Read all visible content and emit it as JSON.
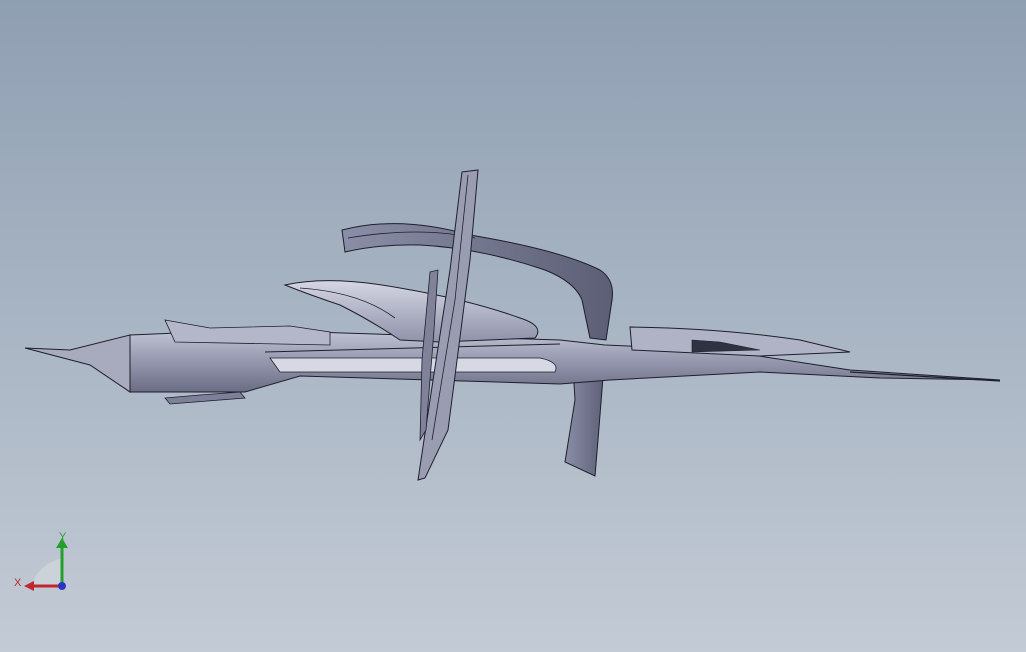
{
  "viewport": {
    "model_icon": "cad-assembly-aircraft",
    "colors": {
      "background_top": "#8f9fb2",
      "background_bottom": "#c3cbd5",
      "part_light": "#b9bdd0",
      "part_mid": "#8d91a8",
      "part_dark": "#5f6279",
      "edge": "#1e1f2a"
    }
  },
  "triad": {
    "x_label": "X",
    "y_label": "Y",
    "x_color": "#c0282d",
    "y_color": "#22a02a",
    "z_color": "#2a34c8"
  }
}
